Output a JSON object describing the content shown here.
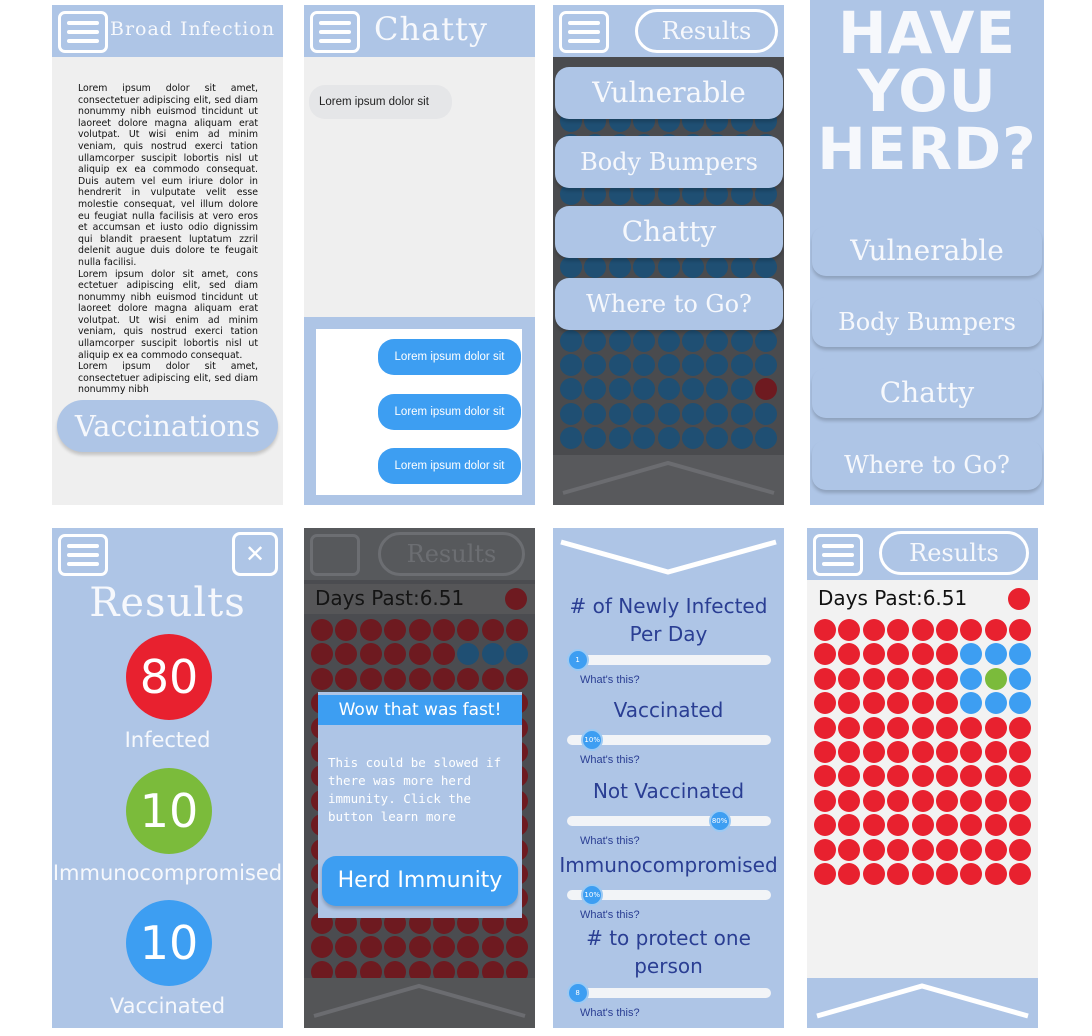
{
  "panel1": {
    "title": "Broad Infection",
    "paragraphs": [
      "Lorem ipsum dolor sit amet, consectetuer adipiscing elit, sed diam nonummy nibh euismod tincidunt ut laoreet dolore magna aliquam erat volutpat. Ut wisi enim ad minim veniam, quis nostrud exerci tation ullamcorper suscipit lobortis nisl ut aliquip ex ea commodo consequat. Duis autem vel eum iriure dolor in hendrerit in vulputate velit esse molestie consequat, vel illum dolore eu feugiat nulla facilisis at vero eros et accumsan et iusto odio dignissim qui blandit praesent luptatum zzril delenit augue duis dolore te feugait nulla facilisi.",
      "Lorem ipsum dolor sit amet, cons ectetuer adipiscing elit, sed diam nonummy nibh euismod tincidunt ut laoreet dolore magna aliquam erat volutpat. Ut wisi enim ad minim veniam, quis nostrud exerci tation ullamcorper suscipit lobortis nisl ut aliquip ex ea commodo consequat.",
      "Lorem ipsum dolor sit amet, consectetuer adipiscing elit, sed diam nonummy nibh"
    ],
    "button": "Vaccinations"
  },
  "panel2": {
    "title": "Chatty",
    "incoming": "Lorem ipsum dolor sit",
    "outgoing": [
      "Lorem ipsum dolor sit",
      "Lorem ipsum dolor sit",
      "Lorem ipsum dolor sit"
    ]
  },
  "panel3": {
    "results_button": "Results",
    "menu_items": [
      "Vulnerable",
      "Body Bumpers",
      "Chatty",
      "Where to Go?"
    ]
  },
  "panel4": {
    "heading_lines": [
      "HAVE",
      "YOU",
      "HERD?"
    ],
    "menu_items": [
      "Vulnerable",
      "Body Bumpers",
      "Chatty",
      "Where to Go?"
    ]
  },
  "panel5": {
    "close_glyph": "✕",
    "title": "Results",
    "stats": [
      {
        "value": "80",
        "label": "Infected",
        "color": "#e8212f"
      },
      {
        "value": "10",
        "label": "Immunocompromised",
        "color": "#7bbb3b"
      },
      {
        "value": "10",
        "label": "Vaccinated",
        "color": "#3d9ef2"
      }
    ]
  },
  "panel6": {
    "results_button": "Results",
    "days_label": "Days Past:6.51",
    "popup_title": "Wow that was fast!",
    "popup_text": "This could be slowed if there was more herd immunity. Click the button learn more",
    "popup_button": "Herd Immunity"
  },
  "panel7": {
    "sliders": [
      {
        "title": "# of Newly Infected Per Day",
        "value": "1",
        "level": 0.02
      },
      {
        "title": "Vaccinated",
        "value": "10%",
        "level": 0.1
      },
      {
        "title": "Not Vaccinated",
        "value": "80%",
        "level": 0.8
      },
      {
        "title": "Immunocompromised",
        "value": "10%",
        "level": 0.1
      },
      {
        "title": "# to protect one person",
        "value": "8",
        "level": 0.02
      }
    ],
    "help_text": "What's this?"
  },
  "panel8": {
    "results_button": "Results",
    "days_label": "Days Past:6.51"
  },
  "colors": {
    "accent": "#aec5e6",
    "infected": "#e8212f",
    "vaccinated": "#3d9ef2",
    "immunocompromised": "#7bbb3b",
    "slider_text": "#2a3e93"
  }
}
